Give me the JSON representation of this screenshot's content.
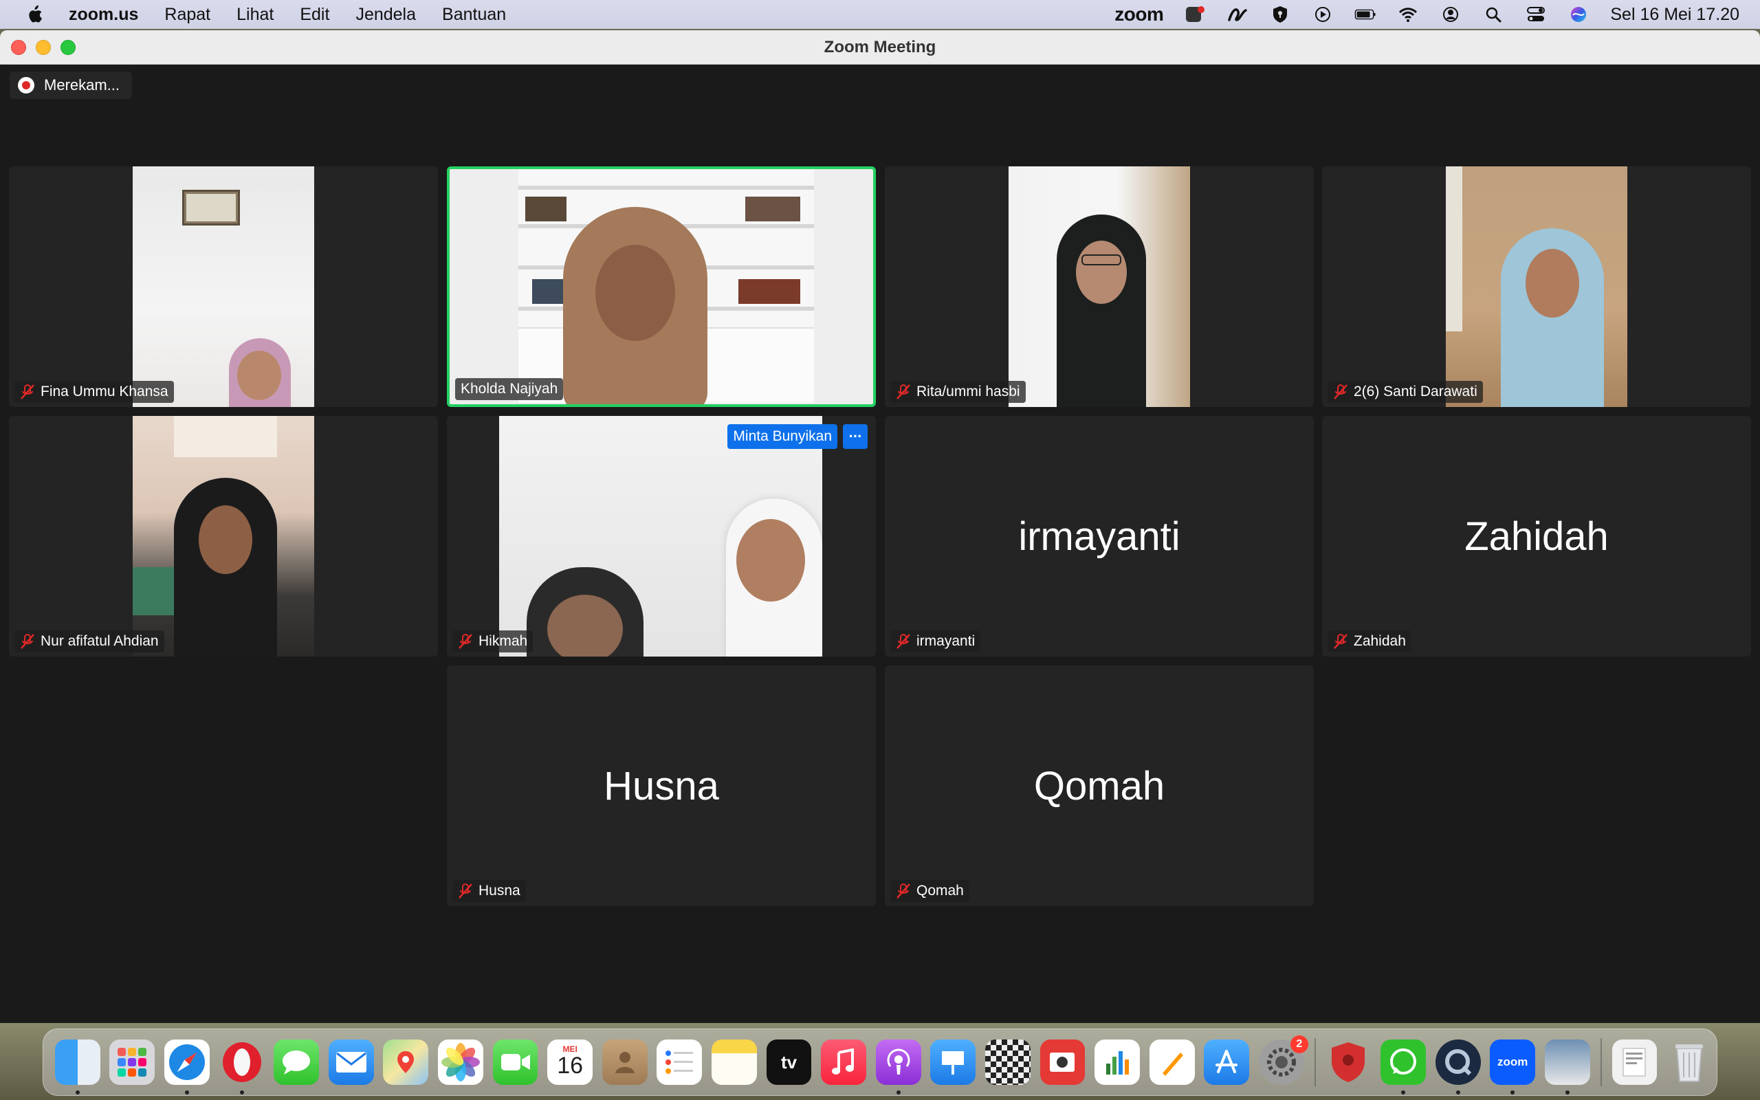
{
  "menubar": {
    "app_name": "zoom.us",
    "menus": [
      "Rapat",
      "Lihat",
      "Edit",
      "Jendela",
      "Bantuan"
    ],
    "zoom_label": "zoom",
    "datetime": "Sel 16 Mei  17.20"
  },
  "window": {
    "title": "Zoom Meeting",
    "recording_label": "Merekam..."
  },
  "participants": [
    {
      "name": "Fina Ummu Khansa",
      "muted": true,
      "video": true
    },
    {
      "name": "Kholda Najiyah",
      "muted": false,
      "video": true,
      "active_speaker": true
    },
    {
      "name": "Rita/ummi hasbi",
      "muted": true,
      "video": true
    },
    {
      "name": "2(6) Santi Darawati",
      "muted": true,
      "video": true
    },
    {
      "name": "Nur afifatul Ahdian",
      "muted": true,
      "video": true
    },
    {
      "name": "Hikmah",
      "muted": true,
      "video": true,
      "hover_action": "Minta Bunyikan",
      "more_label": "···"
    },
    {
      "name": "irmayanti",
      "muted": true,
      "video": false
    },
    {
      "name": "Zahidah",
      "muted": true,
      "video": false
    },
    {
      "name": "Husna",
      "muted": true,
      "video": false
    },
    {
      "name": "Qomah",
      "muted": true,
      "video": false
    }
  ],
  "dock": {
    "calendar_month": "MEI",
    "calendar_day": "16",
    "tv_label": "tv",
    "settings_badge": "2",
    "zoom_label": "zoom"
  },
  "colors": {
    "active_speaker_border": "#23d160",
    "button_blue": "#0e71eb",
    "mute_red": "#e02828",
    "tile_bg": "#242424"
  }
}
